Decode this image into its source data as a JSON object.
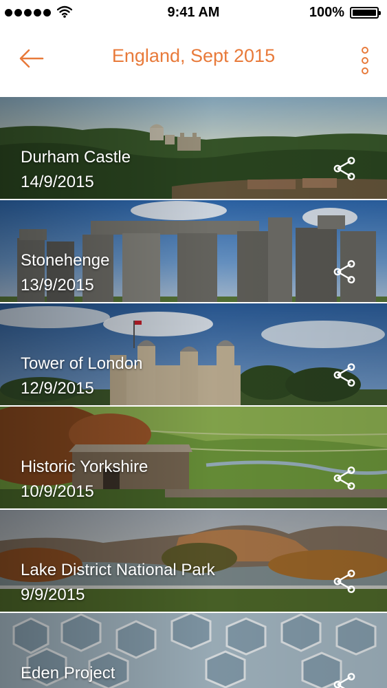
{
  "status_bar": {
    "time": "9:41 AM",
    "battery": "100%",
    "signal_icon": "signal-dots-icon",
    "wifi_icon": "wifi-icon",
    "battery_icon": "battery-full-icon"
  },
  "nav": {
    "title": "England, Sept 2015",
    "back_icon": "arrow-left-icon",
    "more_icon": "more-vertical-icon"
  },
  "colors": {
    "accent": "#e87a3a",
    "text_on_image": "#ffffff"
  },
  "places": [
    {
      "name": "Durham Castle",
      "date": "14/9/2015",
      "scene": "castle on wooded hill"
    },
    {
      "name": "Stonehenge",
      "date": "13/9/2015",
      "scene": "standing stones under blue sky"
    },
    {
      "name": "Tower of London",
      "date": "12/9/2015",
      "scene": "stone fortress with turrets"
    },
    {
      "name": "Historic Yorkshire",
      "date": "10/9/2015",
      "scene": "stone barn in green valley"
    },
    {
      "name": "Lake District National Park",
      "date": "9/9/2015",
      "scene": "lake with autumn trees and fells"
    },
    {
      "name": "Eden Project",
      "date": "",
      "scene": "hexagonal biome domes"
    }
  ],
  "share_icon": "share-icon"
}
